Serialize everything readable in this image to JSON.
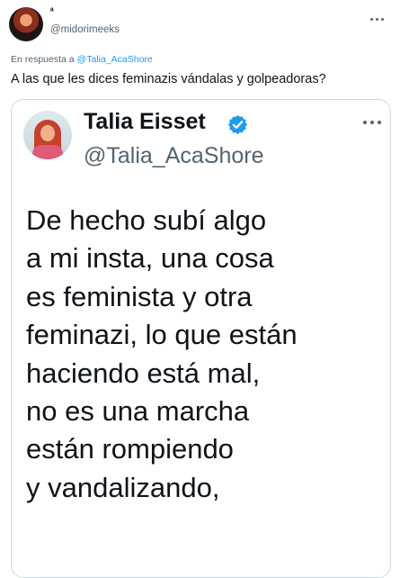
{
  "tweet": {
    "author": {
      "display_name": "ᵃ",
      "handle": "@midorimeeks",
      "avatar": "profile-photo"
    },
    "more_icon": "ellipsis-icon",
    "reply_prefix": "En respuesta a",
    "reply_to": "@Talia_AcaShore",
    "text": "A las que les dices feminazis vándalas y golpeadoras?"
  },
  "quoted": {
    "display_name": "Talia Eisset",
    "handle": "@Talia_AcaShore",
    "verified_icon": "verified-badge-icon",
    "more_icon": "ellipsis-icon",
    "text": "De hecho subí algo\na mi insta, una cosa\nes feminista y otra\nfeminazi, lo que están\nhaciendo está mal,\nno es una marcha\nestán rompiendo\ny vandalizando,",
    "colors": {
      "verified": "#1d9bf0",
      "link": "#1d9bf0",
      "muted": "#536471"
    }
  }
}
